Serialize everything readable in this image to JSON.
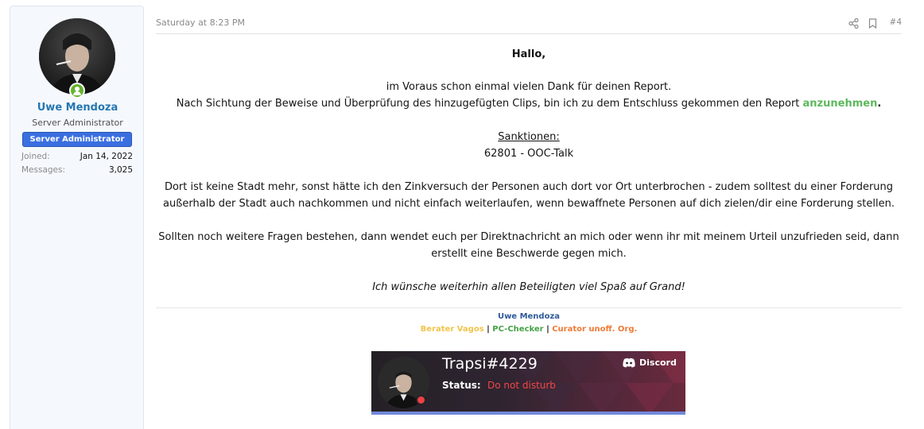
{
  "user": {
    "name": "Uwe Mendoza",
    "title": "Server Administrator",
    "banner": "Server Administrator",
    "online": true,
    "stats": [
      {
        "label": "Joined:",
        "value": "Jan 14, 2022"
      },
      {
        "label": "Messages:",
        "value": "3,025"
      }
    ]
  },
  "post": {
    "date": "Saturday at 8:23 PM",
    "number": "#4",
    "greeting": "Hallo,",
    "line1": "im Voraus schon einmal vielen Dank für deinen Report.",
    "line2_pre": "Nach Sichtung der Beweise und Überprüfung des hinzugefügten Clips, bin ich zu dem Entschluss gekommen den Report ",
    "line2_highlight": "anzunehmen",
    "line2_post": ".",
    "sanctions_heading": "Sanktionen:",
    "sanction": "62801 - OOC-Talk",
    "para2_line1": "Dort ist keine Stadt mehr, sonst hätte ich den Zinkversuch der Personen auch dort vor Ort unterbrochen - zudem solltest du einer Forderung",
    "para2_line2": "außerhalb der Stadt auch nachkommen und nicht einfach weiterlaufen, wenn bewaffnete Personen auf dich zielen/dir eine Forderung stellen.",
    "para3_line1": "Sollten noch weitere Fragen bestehen, dann wendet euch per Direktnachricht an mich oder wenn ihr mit meinem Urteil unzufrieden seid, dann",
    "para3_line2": "erstellt eine Beschwerde gegen mich.",
    "closing": "Ich wünsche weiterhin allen Beteiligten viel Spaß auf Grand!"
  },
  "signature": {
    "name": "Uwe Mendoza",
    "roles": [
      {
        "label": "Berater Vagos",
        "color": "#f0c44a"
      },
      {
        "label": "PC-Checker",
        "color": "#45a247"
      },
      {
        "label": "Curator unoff. Org.",
        "color": "#ef7a36"
      }
    ],
    "separator": "|"
  },
  "discord": {
    "username": "Trapsi#4229",
    "status_label": "Status:",
    "status_value": "Do not disturb",
    "brand": "Discord",
    "status_color": "#ed4245"
  },
  "colors": {
    "link_blue": "#2577b1",
    "accept_green": "#5cb85c",
    "banner_blue": "#3a6fe0"
  }
}
